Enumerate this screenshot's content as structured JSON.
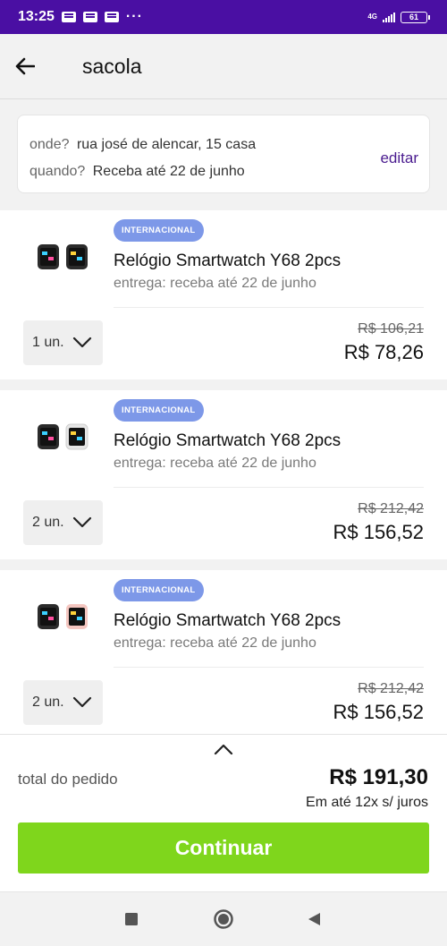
{
  "status_bar": {
    "time": "13:25",
    "more": "···",
    "network": "4G",
    "battery": "61"
  },
  "header": {
    "title": "sacola"
  },
  "address": {
    "where_label": "onde?",
    "where_value": "rua josé de alencar, 15 casa",
    "when_label": "quando?",
    "when_value": "Receba até 22 de junho",
    "edit_label": "editar"
  },
  "items": [
    {
      "badge": "INTERNACIONAL",
      "name": "Relógio Smartwatch Y68 2pcs",
      "delivery": "entrega: receba até 22 de junho",
      "quantity": "1 un.",
      "old_price": "R$ 106,21",
      "price": "R$ 78,26"
    },
    {
      "badge": "INTERNACIONAL",
      "name": "Relógio Smartwatch Y68 2pcs",
      "delivery": "entrega: receba até 22 de junho",
      "quantity": "2 un.",
      "old_price": "R$ 212,42",
      "price": "R$ 156,52"
    },
    {
      "badge": "INTERNACIONAL",
      "name": "Relógio Smartwatch Y68 2pcs",
      "delivery": "entrega: receba até 22 de junho",
      "quantity": "2 un.",
      "old_price": "R$ 212,42",
      "price": "R$ 156,52"
    }
  ],
  "summary": {
    "total_label": "total do pedido",
    "total_value": "R$ 191,30",
    "installments": "Em até 12x s/ juros",
    "continue_label": "Continuar"
  },
  "colors": {
    "status_bar": "#4a0fa3",
    "accent_link": "#4a1b8f",
    "badge": "#7d98e8",
    "continue_button": "#7fd61c"
  },
  "icons": {
    "back": "arrow-left-icon",
    "dropdown": "chevron-down-icon",
    "expand": "chevron-up-icon",
    "nav_recent": "square-icon",
    "nav_home": "circle-icon",
    "nav_back": "triangle-left-icon"
  }
}
